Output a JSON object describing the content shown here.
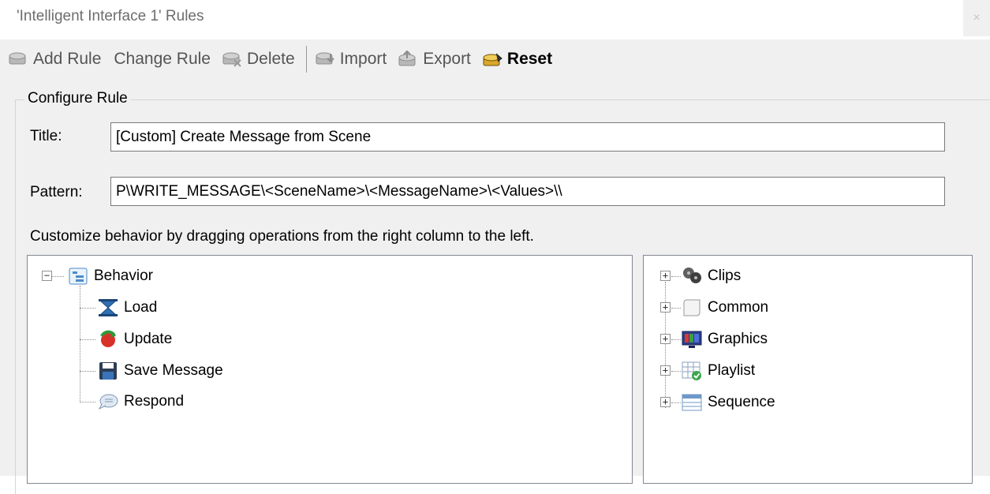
{
  "window": {
    "title": "'Intelligent Interface 1' Rules",
    "close_glyph": "×"
  },
  "toolbar": {
    "add_rule": "Add Rule",
    "change_rule": "Change Rule",
    "delete": "Delete",
    "import": "Import",
    "export": "Export",
    "reset": "Reset"
  },
  "configure": {
    "group_title": "Configure Rule",
    "title_label": "Title:",
    "title_value": "[Custom] Create Message from Scene",
    "pattern_label": "Pattern:",
    "pattern_value": "P\\WRITE_MESSAGE\\<SceneName>\\<MessageName>\\<Values>\\\\",
    "hint": "Customize behavior by dragging operations from the right column to the left."
  },
  "behavior_tree": {
    "root": {
      "label": "Behavior",
      "icon": "behavior-tree-icon",
      "expander": "−"
    },
    "children": [
      {
        "label": "Load",
        "icon": "load-hourglass-icon"
      },
      {
        "label": "Update",
        "icon": "update-refresh-icon"
      },
      {
        "label": "Save Message",
        "icon": "floppy-disk-icon"
      },
      {
        "label": "Respond",
        "icon": "speech-bubble-icon"
      }
    ]
  },
  "operations_tree": {
    "items": [
      {
        "label": "Clips",
        "icon": "film-reel-icon",
        "expander": "+"
      },
      {
        "label": "Common",
        "icon": "scroll-icon",
        "expander": "+"
      },
      {
        "label": "Graphics",
        "icon": "monitor-icon",
        "expander": "+"
      },
      {
        "label": "Playlist",
        "icon": "playlist-grid-icon",
        "expander": "+"
      },
      {
        "label": "Sequence",
        "icon": "sequence-list-icon",
        "expander": "+"
      }
    ]
  }
}
